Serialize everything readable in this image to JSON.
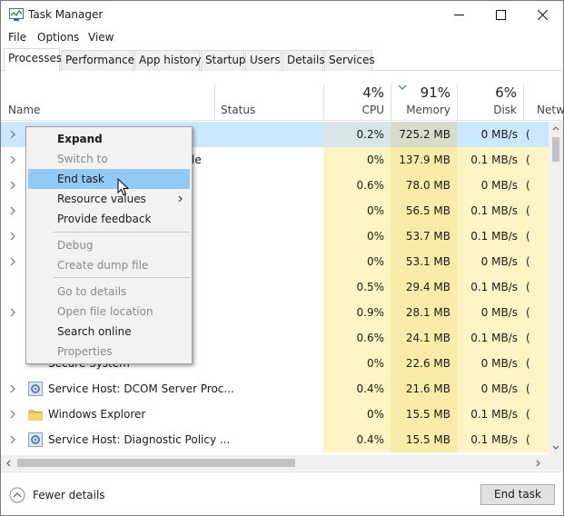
{
  "window": {
    "title": "Task Manager",
    "minimize": "—",
    "maximize": "☐",
    "close": "✕"
  },
  "menu": [
    "File",
    "Options",
    "View"
  ],
  "tabs": [
    "Processes",
    "Performance",
    "App history",
    "Startup",
    "Users",
    "Details",
    "Services"
  ],
  "columns": {
    "name": "Name",
    "status": "Status",
    "cpu": {
      "pct": "4%",
      "label": "CPU"
    },
    "memory": {
      "pct": "91%",
      "label": "Memory"
    },
    "disk": {
      "pct": "6%",
      "label": "Disk"
    },
    "network": {
      "label": "Netw"
    }
  },
  "rows": [
    {
      "name": "",
      "cpu": "0.2%",
      "mem": "725.2 MB",
      "disk": "0 MB/s",
      "net": "(",
      "selected": true,
      "chevron": true
    },
    {
      "name": "le",
      "cpu": "0%",
      "mem": "137.9 MB",
      "disk": "0.1 MB/s",
      "net": "(",
      "chevron": true
    },
    {
      "name": "",
      "cpu": "0.6%",
      "mem": "78.0 MB",
      "disk": "0 MB/s",
      "net": "(",
      "chevron": true
    },
    {
      "name": "",
      "cpu": "0%",
      "mem": "56.5 MB",
      "disk": "0.1 MB/s",
      "net": "(",
      "chevron": true
    },
    {
      "name": "",
      "cpu": "0%",
      "mem": "53.7 MB",
      "disk": "0.1 MB/s",
      "net": "(",
      "chevron": true
    },
    {
      "name": "",
      "cpu": "0%",
      "mem": "53.1 MB",
      "disk": "0 MB/s",
      "net": "(",
      "chevron": true
    },
    {
      "name": "",
      "cpu": "0.5%",
      "mem": "29.4 MB",
      "disk": "0.1 MB/s",
      "net": "(",
      "chevron": false
    },
    {
      "name": "",
      "cpu": "0.9%",
      "mem": "28.1 MB",
      "disk": "0 MB/s",
      "net": "(",
      "chevron": true
    },
    {
      "name": "",
      "cpu": "0.6%",
      "mem": "24.1 MB",
      "disk": "0.1 MB/s",
      "net": "(",
      "chevron": false
    },
    {
      "name": "Secure System",
      "cpu": "0%",
      "mem": "22.6 MB",
      "disk": "0 MB/s",
      "net": "(",
      "chevron": false
    },
    {
      "name": "Service Host: DCOM Server Proc...",
      "cpu": "0.4%",
      "mem": "21.6 MB",
      "disk": "0 MB/s",
      "net": "(",
      "chevron": true,
      "icon": "gear-icon"
    },
    {
      "name": "Windows Explorer",
      "cpu": "0%",
      "mem": "15.5 MB",
      "disk": "0.1 MB/s",
      "net": "(",
      "chevron": true,
      "icon": "folder-icon"
    },
    {
      "name": "Service Host: Diagnostic Policy ...",
      "cpu": "0.4%",
      "mem": "15.5 MB",
      "disk": "0.1 MB/s",
      "net": "(",
      "chevron": true,
      "icon": "gear-icon"
    }
  ],
  "context_menu": {
    "items": [
      {
        "label": "Expand",
        "bold": true
      },
      {
        "label": "Switch to",
        "disabled": true
      },
      {
        "label": "End task",
        "hover": true
      },
      {
        "label": "Resource values",
        "submenu": true
      },
      {
        "label": "Provide feedback"
      },
      {
        "label": "Debug",
        "disabled": true
      },
      {
        "label": "Create dump file",
        "disabled": true
      },
      {
        "label": "Go to details",
        "disabled": true
      },
      {
        "label": "Open file location",
        "disabled": true
      },
      {
        "label": "Search online"
      },
      {
        "label": "Properties",
        "disabled": true
      }
    ]
  },
  "footer": {
    "fewer_details": "Fewer details",
    "end_task": "End task"
  },
  "colors": {
    "cpu_cell": "#fff4c4",
    "mem_cell": "#f9eca8",
    "selected_row": "#cce8ff",
    "menu_hover": "#91c9f7"
  }
}
